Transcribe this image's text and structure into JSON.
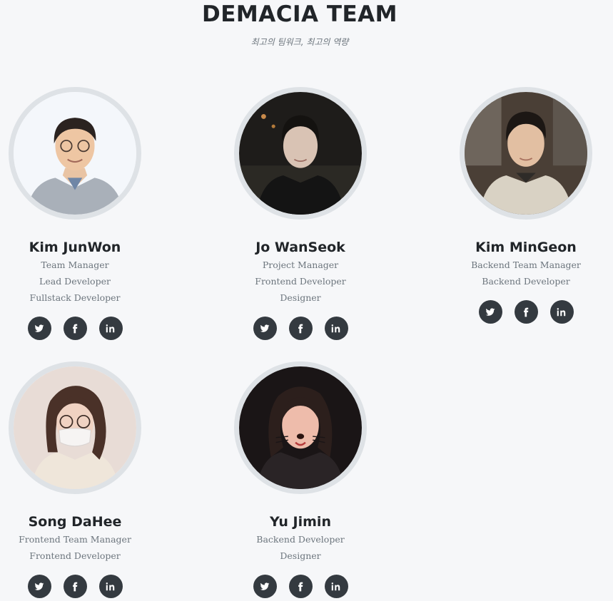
{
  "header": {
    "title": "DEMACIA TEAM",
    "subtitle": "최고의 팀워크, 최고의 역량"
  },
  "members": [
    {
      "name": "Kim JunWon",
      "roles": [
        "Team Manager",
        "Lead Developer",
        "Fullstack Developer"
      ]
    },
    {
      "name": "Jo WanSeok",
      "roles": [
        "Project Manager",
        "Frontend Developer",
        "Designer"
      ]
    },
    {
      "name": "Kim MinGeon",
      "roles": [
        "Backend Team Manager",
        "Backend Developer"
      ]
    },
    {
      "name": "Song DaHee",
      "roles": [
        "Frontend Team Manager",
        "Frontend Developer"
      ]
    },
    {
      "name": "Yu Jimin",
      "roles": [
        "Backend Developer",
        "Designer"
      ]
    }
  ],
  "social_icons": [
    "twitter-icon",
    "facebook-icon",
    "linkedin-icon"
  ],
  "colors": {
    "background": "#f6f7f9",
    "avatar_border": "#dee2e6",
    "social_button": "#343a40",
    "heading": "#212529",
    "muted_text": "#6c757d"
  }
}
